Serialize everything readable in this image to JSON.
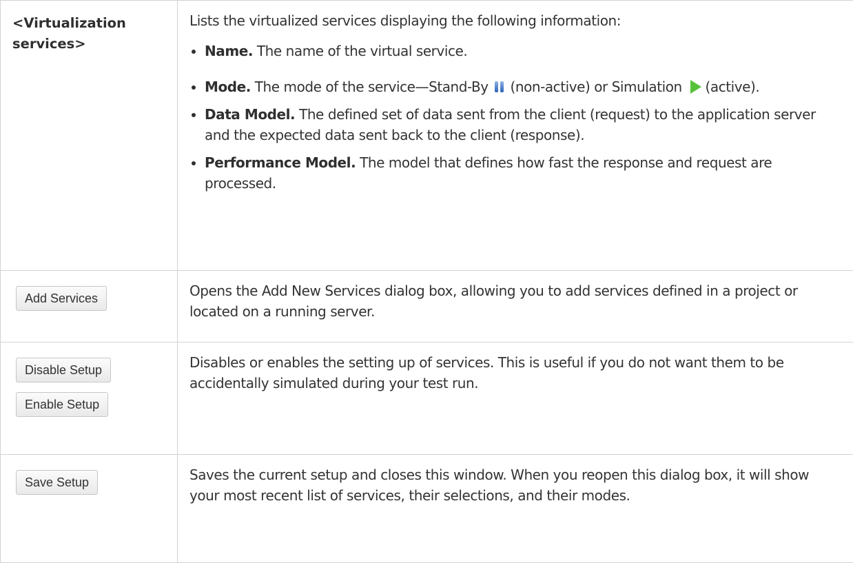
{
  "rows": [
    {
      "ui_element": "<Virtualization services>",
      "intro": "Lists the virtualized services displaying the following information:",
      "bullets": [
        {
          "term": "Name.",
          "text": " The name of the virtual service."
        },
        {
          "term": "Mode.",
          "text_before": " The mode of the service—Stand-By ",
          "text_mid": " (non-active) or Simulation ",
          "text_after": " (active).",
          "icons": [
            "pause-icon",
            "play-icon"
          ]
        },
        {
          "term": "Data Model.",
          "text": " The defined set of data sent from the client (request) to the application server and the expected data sent back to the client (response)."
        },
        {
          "term": "Performance Model.",
          "text": " The model that defines how fast the response and request are processed."
        }
      ]
    },
    {
      "button_label": "Add Services",
      "description": "Opens the Add New Services dialog box, allowing you to add services defined in a project or located on a running server."
    },
    {
      "button_labels": [
        "Disable Setup",
        "Enable Setup"
      ],
      "description": "Disables or enables the setting up of services. This is useful if you do not want them to be accidentally simulated during your test run."
    },
    {
      "button_label": "Save Setup",
      "description": "Saves the current setup and closes this window. When you reopen this dialog box, it will show your most recent list of services, their selections, and their modes."
    }
  ]
}
